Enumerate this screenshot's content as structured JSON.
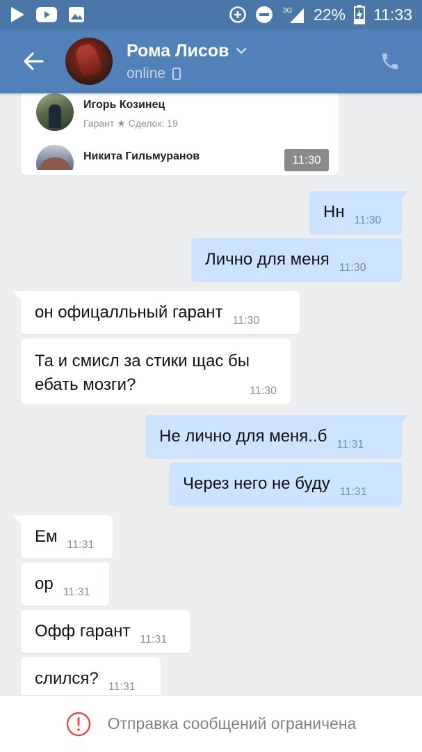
{
  "status_bar": {
    "battery": "22%",
    "time": "11:33",
    "network": "3G"
  },
  "header": {
    "contact_name": "Рома Лисов",
    "status": "online"
  },
  "forwarded": {
    "users": [
      {
        "name": "Игорь Козинец",
        "subtitle": "Гарант ★ Сделок: 19"
      },
      {
        "name": "Никита Гильмуранов"
      }
    ],
    "time": "11:30"
  },
  "messages": [
    {
      "dir": "out",
      "text": "Нн",
      "time": "11:30"
    },
    {
      "dir": "out",
      "text": "Лично для меня",
      "time": "11:30"
    },
    {
      "dir": "in",
      "text": "он офицалльный гарант",
      "time": "11:30"
    },
    {
      "dir": "in",
      "text": "Та и смисл за стики щас бы\nебать мозги?",
      "time": "11:30"
    },
    {
      "dir": "out",
      "text": "Не лично для меня..б",
      "time": "11:31"
    },
    {
      "dir": "out",
      "text": "Через него не буду",
      "time": "11:31"
    },
    {
      "dir": "in",
      "text": "Ем",
      "time": "11:31"
    },
    {
      "dir": "in",
      "text": "ор",
      "time": "11:31"
    },
    {
      "dir": "in",
      "text": "Офф гарант",
      "time": "11:31"
    },
    {
      "dir": "in",
      "text": "слился?",
      "time": "11:31"
    }
  ],
  "footer": {
    "restricted_text": "Отправка сообщений ограничена"
  },
  "colors": {
    "status_bar": "#4a76a8",
    "header": "#5181b8",
    "chat_bg": "#edeef0",
    "outgoing_bubble": "#cce4ff",
    "incoming_bubble": "#ffffff",
    "alert_red": "#e64646"
  },
  "icons": {
    "status_bar": [
      "play-icon",
      "youtube-icon",
      "gallery-icon",
      "data-saver-icon",
      "dnd-icon",
      "signal-icon",
      "battery-charging-icon"
    ],
    "header": [
      "back-arrow-icon",
      "chevron-down-icon",
      "mobile-device-icon",
      "phone-icon"
    ],
    "footer": [
      "alert-circle-icon"
    ]
  }
}
